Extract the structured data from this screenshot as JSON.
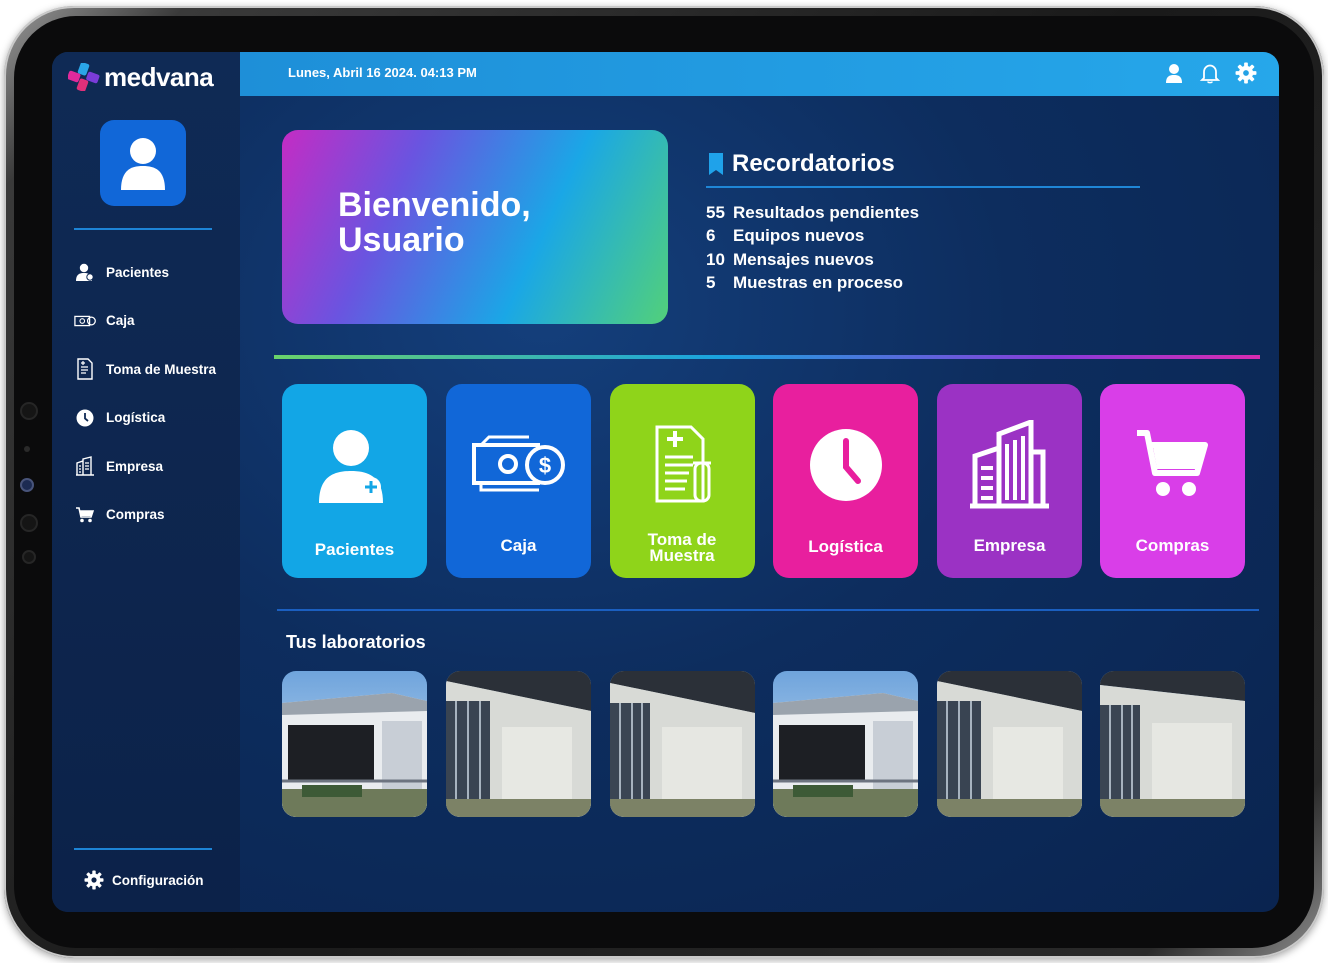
{
  "app": {
    "brand": "medvana"
  },
  "topbar": {
    "datetime": "Lunes, Abril 16 2024. 04:13 PM",
    "icons": [
      "user-icon",
      "bell-icon",
      "gear-icon"
    ]
  },
  "sidebar": {
    "items": [
      {
        "label": "Pacientes",
        "icon": "user-icon"
      },
      {
        "label": "Caja",
        "icon": "cash-icon"
      },
      {
        "label": "Toma de Muestra",
        "icon": "document-icon"
      },
      {
        "label": "Logística",
        "icon": "clock-icon"
      },
      {
        "label": "Empresa",
        "icon": "building-icon"
      },
      {
        "label": "Compras",
        "icon": "cart-icon"
      }
    ],
    "config_label": "Configuración"
  },
  "welcome": {
    "line1": "Bienvenido,",
    "line2": "Usuario"
  },
  "reminders": {
    "title": "Recordatorios",
    "items": [
      {
        "count": "55",
        "text": "Resultados pendientes"
      },
      {
        "count": "6",
        "text": "Equipos nuevos"
      },
      {
        "count": "10",
        "text": "Mensajes nuevos"
      },
      {
        "count": "5",
        "text": "Muestras en proceso"
      }
    ]
  },
  "tiles": [
    {
      "label": "Pacientes",
      "color": "#12a6e6"
    },
    {
      "label": "Caja",
      "color": "#1167d8"
    },
    {
      "label": "Toma de Muestra",
      "color": "#8fd41a"
    },
    {
      "label": "Logística",
      "color": "#e81f9e"
    },
    {
      "label": "Empresa",
      "color": "#9b32c4"
    },
    {
      "label": "Compras",
      "color": "#d93ee8"
    }
  ],
  "labs": {
    "title": "Tus laboratorios"
  },
  "colors": {
    "sidebar": "#0f2a55",
    "topbar": "#26a7ea",
    "accent": "#1f86d6"
  }
}
